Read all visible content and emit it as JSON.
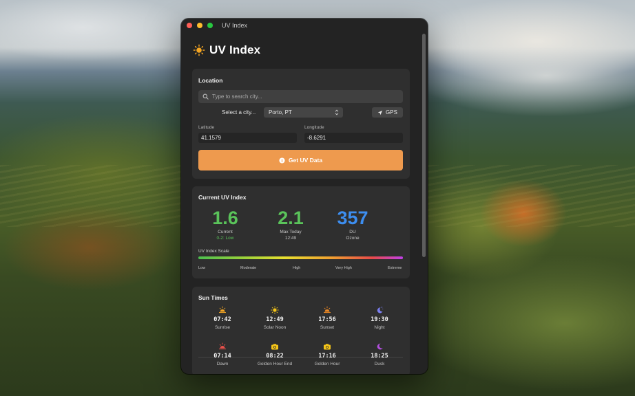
{
  "window": {
    "title": "UV Index"
  },
  "header": {
    "title": "UV Index",
    "icon": "sun-icon"
  },
  "location": {
    "title": "Location",
    "search_placeholder": "Type to search city...",
    "select_label": "Select a city...",
    "selected_city": "Porto, PT",
    "gps_label": "GPS",
    "latitude_label": "Latitude",
    "latitude_value": "41.1579",
    "longitude_label": "Longitude",
    "longitude_value": "-8.6291",
    "button_label": "Get UV Data"
  },
  "current_uv": {
    "title": "Current UV Index",
    "current": {
      "value": "1.6",
      "label": "Current",
      "sub": "0-2: Low",
      "color": "#5ac35a"
    },
    "max_today": {
      "value": "2.1",
      "label": "Max Today",
      "sub": "12:49",
      "color": "#5ac35a"
    },
    "ozone": {
      "value": "357",
      "label": "DU",
      "sub": "Ozone",
      "color": "#3d8ef0"
    },
    "scale_label": "UV Index Scale",
    "scale_ticks": [
      "Low",
      "Moderate",
      "High",
      "Very High",
      "Extreme"
    ]
  },
  "sun_times": {
    "title": "Sun Times",
    "items": [
      {
        "time": "07:42",
        "label": "Sunrise",
        "icon": "sunrise-icon"
      },
      {
        "time": "12:49",
        "label": "Solar Noon",
        "icon": "sun-icon"
      },
      {
        "time": "17:56",
        "label": "Sunset",
        "icon": "sunset-icon"
      },
      {
        "time": "19:30",
        "label": "Night",
        "icon": "moon-stars-icon"
      },
      {
        "time": "07:14",
        "label": "Dawn",
        "icon": "dawn-icon"
      },
      {
        "time": "08:22",
        "label": "Golden Hour End",
        "icon": "camera-icon"
      },
      {
        "time": "17:16",
        "label": "Golden Hour",
        "icon": "camera-icon"
      },
      {
        "time": "18:25",
        "label": "Dusk",
        "icon": "moon-icon"
      }
    ]
  }
}
